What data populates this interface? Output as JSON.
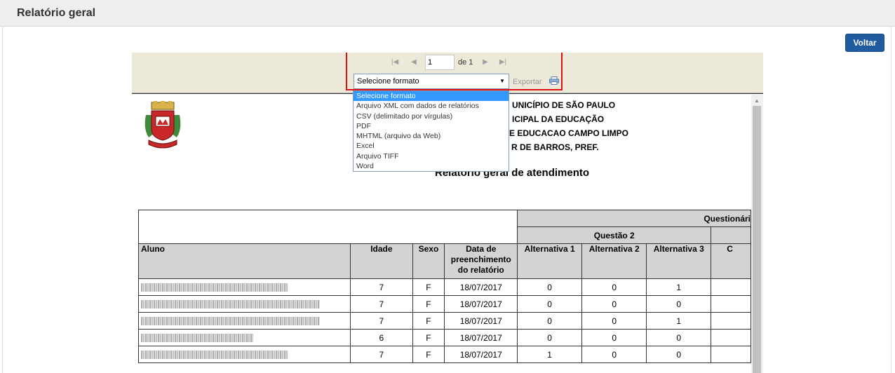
{
  "header": {
    "title": "Relatório geral"
  },
  "actions": {
    "back_label": "Voltar"
  },
  "toolbar": {
    "page_value": "1",
    "page_of": "de 1",
    "format_selected": "Selecione formato",
    "export_label": "Exportar",
    "icons": [
      "first-page-icon",
      "previous-page-icon",
      "next-page-icon",
      "last-page-icon",
      "printer-icon"
    ]
  },
  "format_options": [
    "Selecione formato",
    "Arquivo XML com dados de relatórios",
    "CSV (delimitado por vírgulas)",
    "PDF",
    "MHTML (arquivo da Web)",
    "Excel",
    "Arquivo TIFF",
    "Word"
  ],
  "report": {
    "header_lines": [
      "UNICÍPIO DE SÃO PAULO",
      "ICIPAL DA EDUCAÇÃO",
      "E EDUCACAO CAMPO LIMPO",
      "R DE BARROS, PREF."
    ],
    "title": "Relatorio geral de atendimento",
    "table": {
      "group_header": "Questionári",
      "question_header": "Questão 2",
      "columns": [
        "Aluno",
        "Idade",
        "Sexo",
        "Data de preenchimento do relatório",
        "Alternativa 1",
        "Alternativa 2",
        "Alternativa 3",
        "C"
      ],
      "rows": [
        {
          "idade": "7",
          "sexo": "F",
          "data": "18/07/2017",
          "alt1": "0",
          "alt2": "0",
          "alt3": "1"
        },
        {
          "idade": "7",
          "sexo": "F",
          "data": "18/07/2017",
          "alt1": "0",
          "alt2": "0",
          "alt3": "0"
        },
        {
          "idade": "7",
          "sexo": "F",
          "data": "18/07/2017",
          "alt1": "0",
          "alt2": "0",
          "alt3": "1"
        },
        {
          "idade": "6",
          "sexo": "F",
          "data": "18/07/2017",
          "alt1": "0",
          "alt2": "0",
          "alt3": "0"
        },
        {
          "idade": "7",
          "sexo": "F",
          "data": "18/07/2017",
          "alt1": "1",
          "alt2": "0",
          "alt3": "0"
        }
      ]
    }
  },
  "colors": {
    "accent": "#1f5b9e",
    "highlight": "#e01010",
    "toolbar_bg": "#ece9d8",
    "header_cell_bg": "#d3d3d3",
    "selected_option": "#3399ff"
  }
}
